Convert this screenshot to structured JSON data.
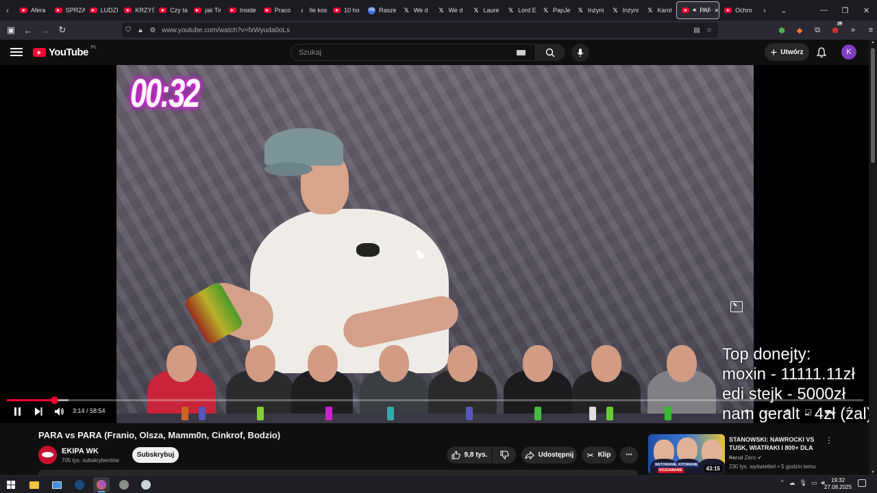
{
  "browser": {
    "tabs": [
      {
        "label": "Afera",
        "icon": "youtube-icon"
      },
      {
        "label": "SPRZĄ",
        "icon": "youtube-icon"
      },
      {
        "label": "LUDZI",
        "icon": "youtube-icon"
      },
      {
        "label": "KRZYŚ",
        "icon": "youtube-icon"
      },
      {
        "label": "Czy ta",
        "icon": "youtube-icon"
      },
      {
        "label": "jak Tir",
        "icon": "youtube-icon"
      },
      {
        "label": "Inside",
        "icon": "youtube-icon"
      },
      {
        "label": "Praco",
        "icon": "youtube-icon"
      },
      {
        "label": "Ile kos",
        "icon": "tiktok-icon"
      },
      {
        "label": "10 ho",
        "icon": "youtube-icon"
      },
      {
        "label": "Rasze",
        "icon": "rebrickable-icon"
      },
      {
        "label": "We d",
        "icon": "x-icon"
      },
      {
        "label": "We d",
        "icon": "x-icon"
      },
      {
        "label": "Laure",
        "icon": "x-icon"
      },
      {
        "label": "Lord E",
        "icon": "x-icon"
      },
      {
        "label": "PapJe",
        "icon": "x-icon"
      },
      {
        "label": "Inżyni",
        "icon": "x-icon"
      },
      {
        "label": "Inżyni",
        "icon": "x-icon"
      },
      {
        "label": "Karol",
        "icon": "x-icon"
      },
      {
        "label": "PAR",
        "icon": "youtube-icon",
        "active": true
      },
      {
        "label": "Ochro",
        "icon": "youtube-icon"
      }
    ],
    "url": "www.youtube.com/watch?v=fxWyuda0oLs",
    "extension_badge": "39"
  },
  "youtube": {
    "logo_text": "YouTube",
    "country_code": "PL",
    "search_placeholder": "Szukaj",
    "create_label": "Utwórz",
    "avatar_letter": "K",
    "avatar_color": "#7c3fc2"
  },
  "player": {
    "overlay_timer": "00:32",
    "current_time": "3:14",
    "duration": "58:54",
    "time_display": "3:14 / 58:54",
    "progress_fraction": 0.0549,
    "buffered_fraction": 0.072,
    "donations_text": "Top donejty:\nmoxin - 11111.11zł\nedi stejk - 5000zł\nnam geralt - 4zł (żal)"
  },
  "video": {
    "title": "PARA vs PARA (Franio, Olsza, Mamm0n, Cinkrof, Bodzio)",
    "channel": "EKIPA WK",
    "subscribers": "705 tys. subskrybentów",
    "subscribe_label": "Subskrybuj",
    "likes": "9,8 tys.",
    "share_label": "Udostępnij",
    "clip_label": "Klip"
  },
  "recommended": {
    "title": "STANOWSKI: NAWROCKI VS TUSK, WIATRAKI I 800+ DLA ...",
    "channel": "Kanał Zero",
    "meta": "230 tys. wyświetleń • 5 godzin temu",
    "duration": "43:15",
    "tag_a": "WETOWANIE, KITOWANIE",
    "tag_b": "ROZDAWANIE"
  },
  "taskbar": {
    "time": "19:32",
    "date": "27.08.2025"
  },
  "colors": {
    "accent_red": "#ff0033",
    "background": "#0f0f0f"
  }
}
